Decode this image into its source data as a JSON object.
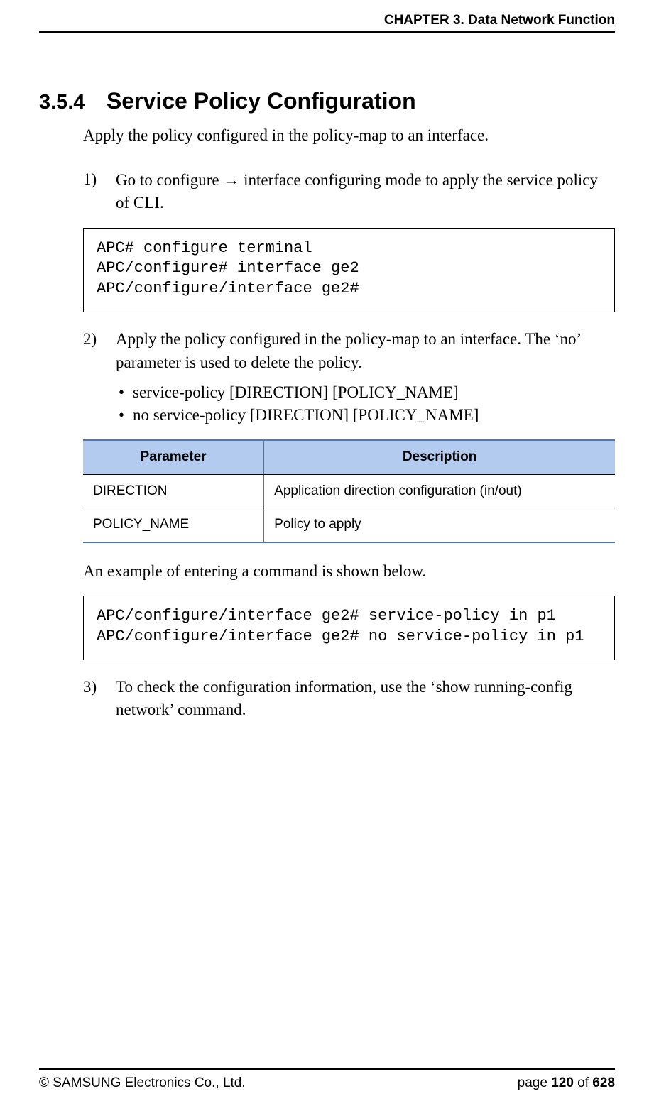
{
  "header": {
    "chapter": "CHAPTER 3. Data Network Function"
  },
  "section": {
    "number": "3.5.4",
    "title": "Service Policy Configuration"
  },
  "intro": "Apply the policy configured in the policy-map to an interface.",
  "steps": {
    "s1": {
      "num": "1)",
      "text_before": "Go to configure ",
      "arrow": "→",
      "text_after": " interface configuring mode to apply the service policy of CLI."
    },
    "s2": {
      "num": "2)",
      "text": "Apply the policy configured in the policy-map to an interface. The ‘no’ parameter is used to delete the policy.",
      "bullets": [
        "service-policy [DIRECTION] [POLICY_NAME]",
        "no service-policy [DIRECTION] [POLICY_NAME]"
      ]
    },
    "s3": {
      "num": "3)",
      "text": "To check the configuration information, use the ‘show running-config network’ command."
    }
  },
  "code1": "APC# configure terminal\nAPC/configure# interface ge2\nAPC/configure/interface ge2#",
  "table": {
    "headers": {
      "param": "Parameter",
      "desc": "Description"
    },
    "rows": [
      {
        "param": "DIRECTION",
        "desc": "Application direction configuration (in/out)"
      },
      {
        "param": "POLICY_NAME",
        "desc": "Policy to apply"
      }
    ]
  },
  "example_note": "An example of entering a command is shown below.",
  "code2": "APC/configure/interface ge2# service-policy in p1\nAPC/configure/interface ge2# no service-policy in p1",
  "footer": {
    "copyright": "© SAMSUNG Electronics Co., Ltd.",
    "page_label": "page ",
    "page_current": "120",
    "page_sep": " of ",
    "page_total": "628"
  }
}
